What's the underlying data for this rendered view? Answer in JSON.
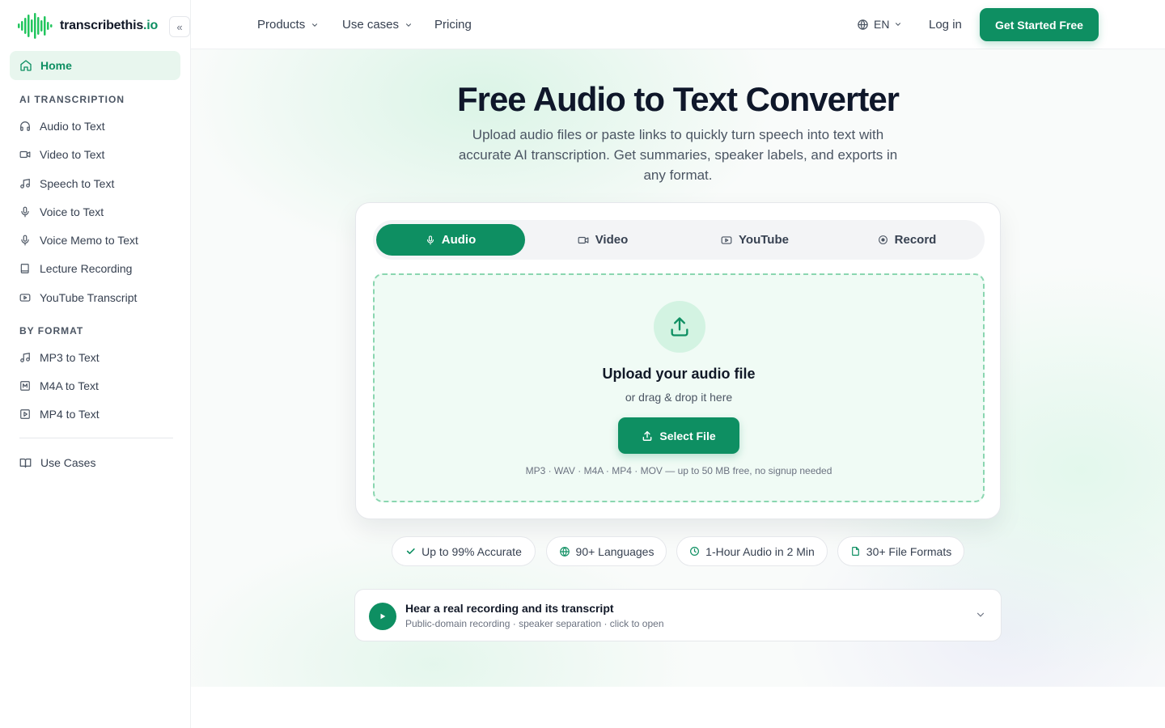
{
  "brand": {
    "name": "transcribethis",
    "tld": ".io"
  },
  "sidebar": {
    "collapse_label": "«",
    "home": "Home",
    "sections": [
      {
        "title": "AI TRANSCRIPTION",
        "items": [
          {
            "label": "Audio to Text",
            "icon": "headphones-icon"
          },
          {
            "label": "Video to Text",
            "icon": "video-icon"
          },
          {
            "label": "Speech to Text",
            "icon": "music-note-icon"
          },
          {
            "label": "Voice to Text",
            "icon": "microphone-icon"
          },
          {
            "label": "Voice Memo to Text",
            "icon": "microphone-icon"
          },
          {
            "label": "Lecture Recording",
            "icon": "book-icon"
          },
          {
            "label": "YouTube Transcript",
            "icon": "youtube-icon"
          }
        ]
      },
      {
        "title": "BY FORMAT",
        "items": [
          {
            "label": "MP3 to Text",
            "icon": "music-note-icon"
          },
          {
            "label": "M4A to Text",
            "icon": "m4a-file-icon"
          },
          {
            "label": "MP4 to Text",
            "icon": "play-file-icon"
          }
        ]
      }
    ],
    "use_cases": "Use Cases"
  },
  "topnav": {
    "products": "Products",
    "use_cases": "Use cases",
    "pricing": "Pricing",
    "language": "EN",
    "login": "Log in",
    "cta": "Get Started Free"
  },
  "hero": {
    "title": "Free Audio to Text Converter",
    "subtitle": "Upload audio files or paste links to quickly turn speech into text with accurate AI transcription. Get summaries, speaker labels, and exports in any format."
  },
  "uploader": {
    "tabs": [
      {
        "label": "Audio",
        "active": true
      },
      {
        "label": "Video",
        "active": false
      },
      {
        "label": "YouTube",
        "active": false
      },
      {
        "label": "Record",
        "active": false
      }
    ],
    "title": "Upload your audio file",
    "subtitle": "or drag & drop it here",
    "button": "Select File",
    "formats": "MP3 · WAV · M4A · MP4 · MOV — up to 50 MB free, no signup needed"
  },
  "badges": [
    {
      "label": "Up to 99% Accurate",
      "icon": "check-icon"
    },
    {
      "label": "90+ Languages",
      "icon": "globe-icon"
    },
    {
      "label": "1-Hour Audio in 2 Min",
      "icon": "clock-icon"
    },
    {
      "label": "30+ File Formats",
      "icon": "file-icon"
    }
  ],
  "sample": {
    "title": "Hear a real recording and its transcript",
    "subtitle": "Public-domain recording · speaker separation · click to open"
  },
  "colors": {
    "accent": "#0e8f62",
    "accent_light": "#e8f6ee",
    "dropzone_border": "#8ad6b0"
  }
}
